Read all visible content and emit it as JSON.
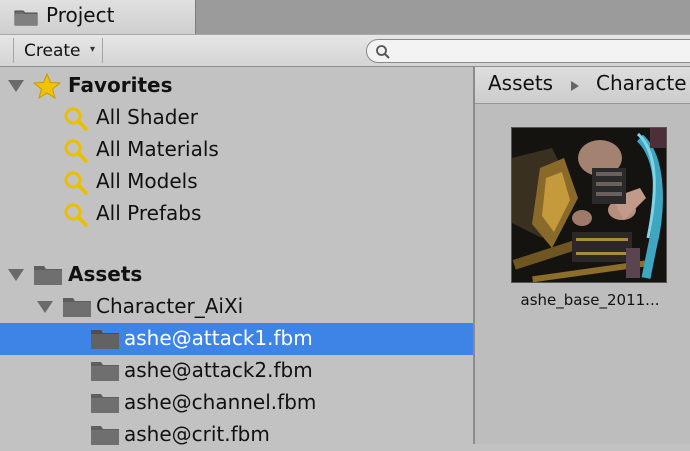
{
  "window": {
    "tab_title": "Project",
    "tab_icon": "folder-icon"
  },
  "toolbar": {
    "create_label": "Create",
    "create_arrow": "▾",
    "search_placeholder": "",
    "search_value": ""
  },
  "tree": {
    "favorites": {
      "label": "Favorites",
      "icon": "star-icon",
      "items": [
        {
          "label": "All Shader",
          "icon": "search-icon"
        },
        {
          "label": "All Materials",
          "icon": "search-icon"
        },
        {
          "label": "All Models",
          "icon": "search-icon"
        },
        {
          "label": "All Prefabs",
          "icon": "search-icon"
        }
      ]
    },
    "assets": {
      "label": "Assets",
      "icon": "folder-icon",
      "character_folder": "Character_AiXi",
      "subfolders": [
        {
          "label": "ashe@attack1.fbm",
          "selected": true
        },
        {
          "label": "ashe@attack2.fbm",
          "selected": false
        },
        {
          "label": "ashe@channel.fbm",
          "selected": false
        },
        {
          "label": "ashe@crit.fbm",
          "selected": false
        }
      ]
    }
  },
  "breadcrumb": [
    "Assets",
    "Characte"
  ],
  "assets_view": {
    "items": [
      {
        "name": "ashe_base_2011...",
        "icon": "texture-thumbnail"
      }
    ]
  },
  "colors": {
    "selection": "#3e83e6",
    "panel": "#c2c2c2",
    "star": "#f2c200",
    "magnifier": "#f2c200"
  }
}
